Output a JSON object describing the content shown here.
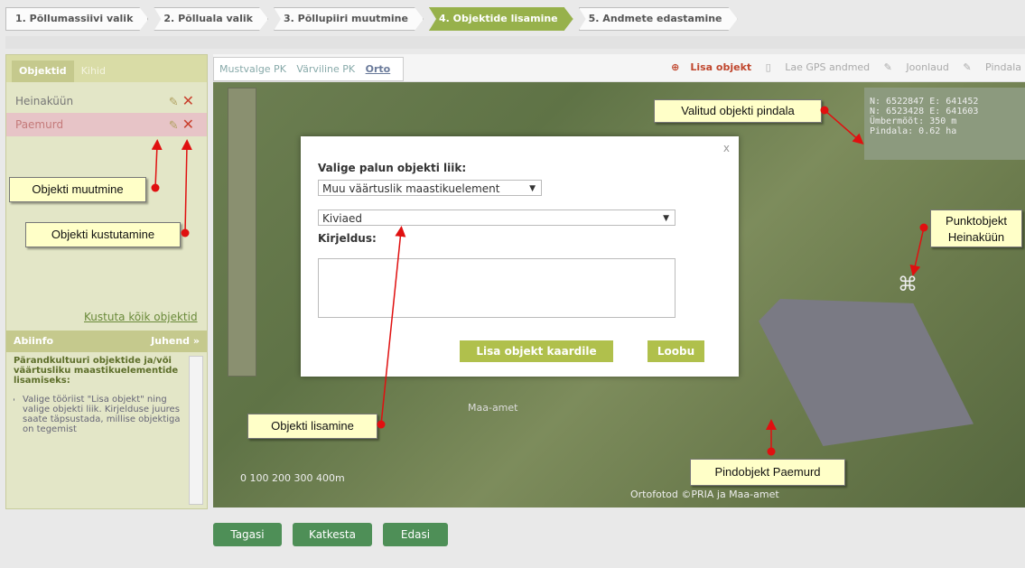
{
  "steps": [
    {
      "label": "1. Põllumassiivi valik",
      "active": false
    },
    {
      "label": "2. Põlluala valik",
      "active": false
    },
    {
      "label": "3. Põllupiiri muutmine",
      "active": false
    },
    {
      "label": "4. Objektide lisamine",
      "active": true
    },
    {
      "label": "5. Andmete edastamine",
      "active": false
    }
  ],
  "left_panel": {
    "tabs": [
      "Objektid",
      "Kihid"
    ],
    "objects": [
      "Heinaküün",
      "Paemurd"
    ],
    "delete_all": "Kustuta kõik objektid",
    "help_tab": "Abiinfo",
    "guide_tab": "Juhend »",
    "help_title": "Pärandkultuuri objektide ja/või väärtusliku maastikuelementide lisamiseks:",
    "help_item": "Valige tööriist \"Lisa objekt\" ning valige objekti liik. Kirjelduse juures saate täpsustada, millise objektiga on tegemist"
  },
  "map": {
    "basemaps": [
      "Mustvalge PK",
      "Värviline PK",
      "Orto"
    ],
    "tools": [
      "Lisa objekt",
      "Lae GPS andmed",
      "Joonlaud",
      "Pindala"
    ],
    "coords": [
      "N: 6522847  E: 641452",
      "N: 6523428  E: 641603",
      "Ümbermõõt: 350 m",
      "Pindala: 0.62 ha"
    ],
    "scale": "0    100   200   300   400m",
    "copyright": "Ortofotod ©PRIA ja Maa-amet",
    "watermark": "Maa-amet"
  },
  "modal": {
    "close": "x",
    "title": "Valige palun objekti liik:",
    "category": "Muu väärtuslik maastikuelement",
    "type": "Kiviaed",
    "desc_label": "Kirjeldus:",
    "add_button": "Lisa objekt kaardile",
    "cancel_button": "Loobu"
  },
  "footer": {
    "back": "Tagasi",
    "cancel": "Katkesta",
    "next": "Edasi"
  },
  "annotations": {
    "edit": "Objekti muutmine",
    "delete": "Objekti kustutamine",
    "area": "Valitud objekti pindala",
    "point": "Punktobjekt Heinaküün",
    "add": "Objekti lisamine",
    "polygon": "Pindobjekt Paemurd"
  },
  "colors": {
    "accent": "#97b14b",
    "annotation_arrow": "#e01010",
    "callout_bg": "#ffffc8"
  }
}
